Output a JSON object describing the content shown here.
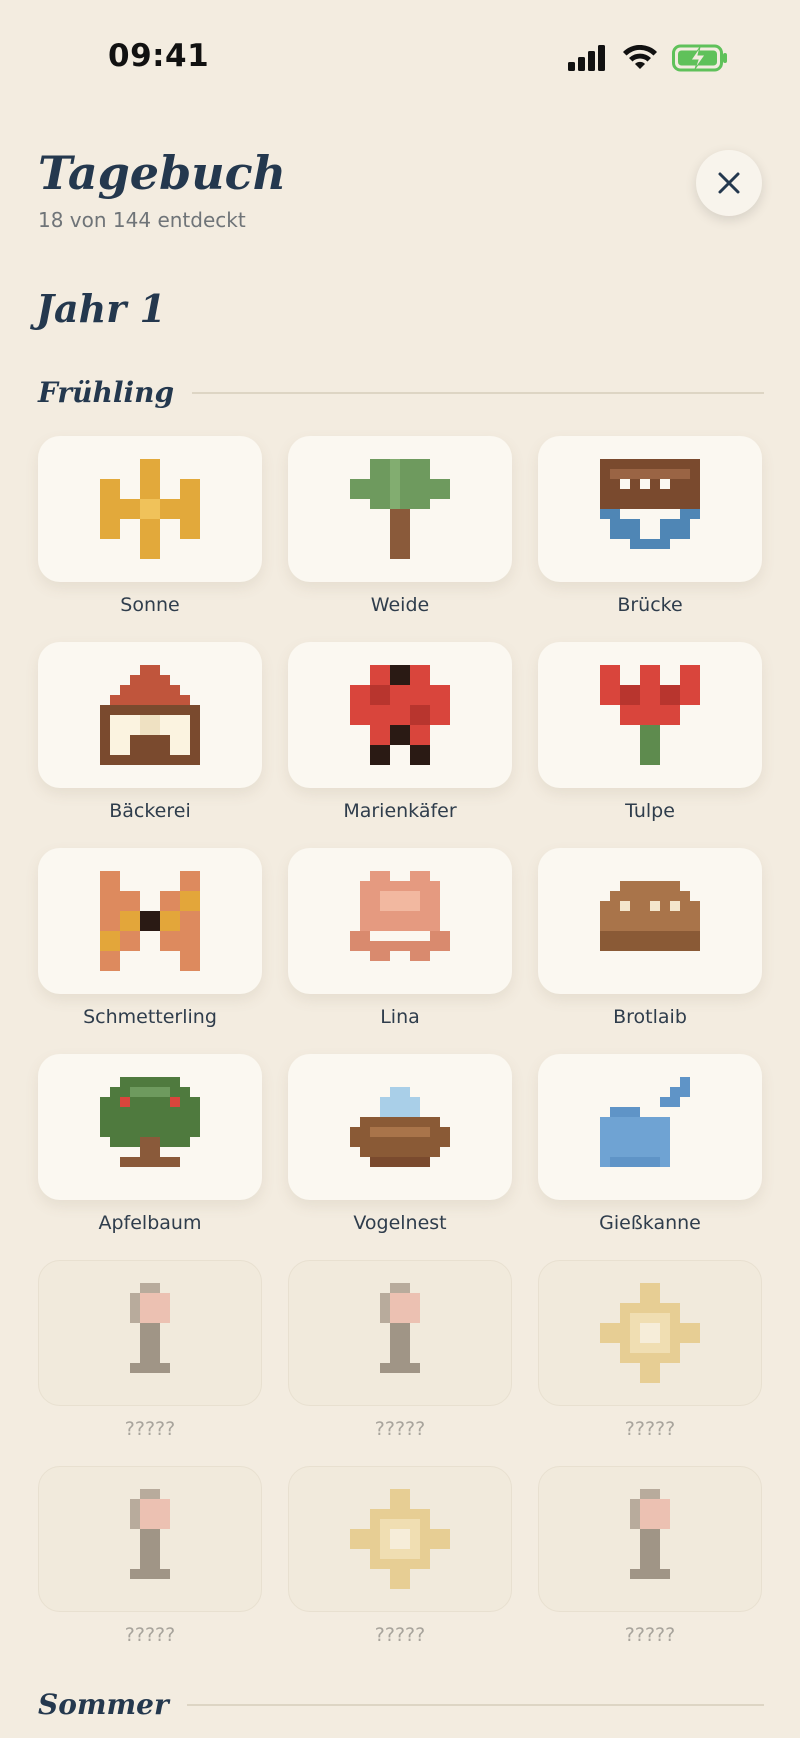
{
  "status_bar": {
    "time": "09:41"
  },
  "header": {
    "title": "Tagebuch",
    "subtitle": "18 von 144 entdeckt"
  },
  "close_icon": "close-icon",
  "year_title": "Jahr 1",
  "seasons": [
    {
      "name": "Frühling",
      "items": [
        {
          "label": "Sonne",
          "icon": "sun-icon",
          "locked": false
        },
        {
          "label": "Weide",
          "icon": "willow-tree-icon",
          "locked": false
        },
        {
          "label": "Brücke",
          "icon": "bridge-icon",
          "locked": false
        },
        {
          "label": "Bäckerei",
          "icon": "bakery-icon",
          "locked": false
        },
        {
          "label": "Marienkäfer",
          "icon": "ladybug-icon",
          "locked": false
        },
        {
          "label": "Tulpe",
          "icon": "tulip-icon",
          "locked": false
        },
        {
          "label": "Schmetterling",
          "icon": "butterfly-icon",
          "locked": false
        },
        {
          "label": "Lina",
          "icon": "lina-character-icon",
          "locked": false
        },
        {
          "label": "Brotlaib",
          "icon": "bread-loaf-icon",
          "locked": false
        },
        {
          "label": "Apfelbaum",
          "icon": "apple-tree-icon",
          "locked": false
        },
        {
          "label": "Vogelnest",
          "icon": "bird-nest-icon",
          "locked": false
        },
        {
          "label": "Gießkanne",
          "icon": "watering-can-icon",
          "locked": false
        },
        {
          "label": "?????",
          "icon": "sign-icon",
          "locked": true
        },
        {
          "label": "?????",
          "icon": "sign-icon",
          "locked": true
        },
        {
          "label": "?????",
          "icon": "sparkle-icon",
          "locked": true
        },
        {
          "label": "?????",
          "icon": "sign-icon",
          "locked": true
        },
        {
          "label": "?????",
          "icon": "sparkle-icon",
          "locked": true
        },
        {
          "label": "?????",
          "icon": "sign-icon",
          "locked": true
        }
      ]
    },
    {
      "name": "Sommer",
      "items": []
    }
  ]
}
